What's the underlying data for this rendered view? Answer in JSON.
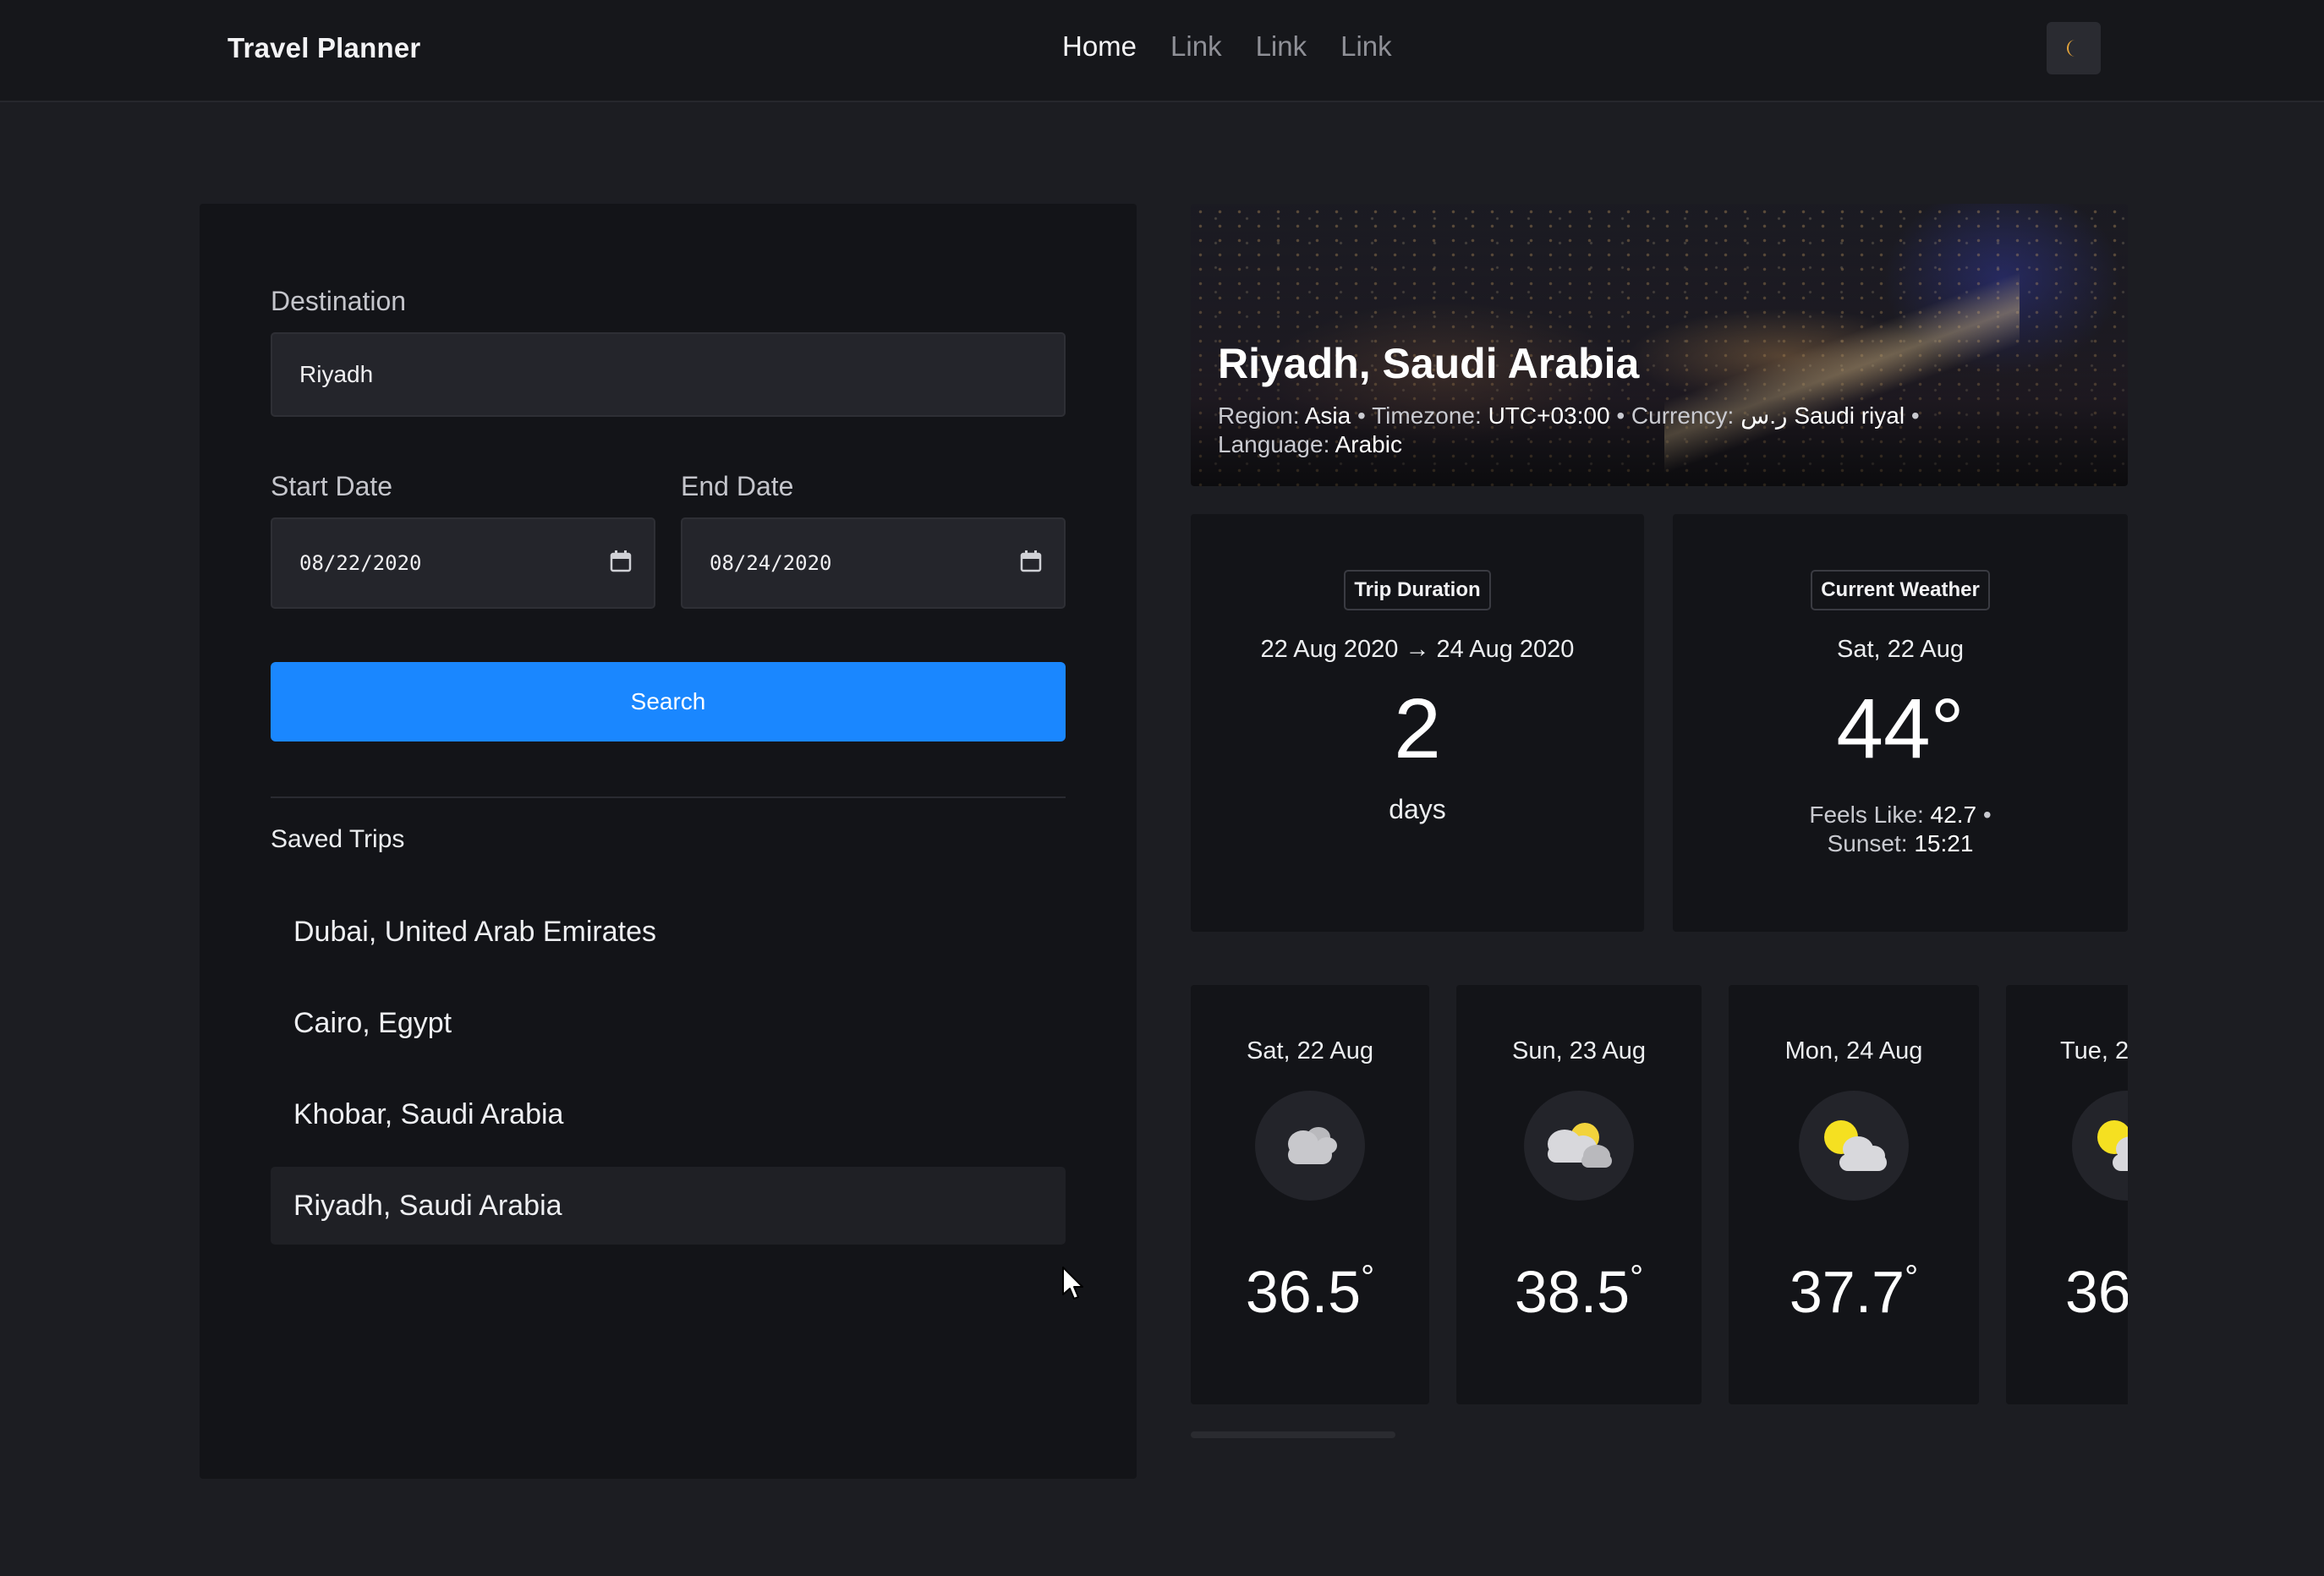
{
  "navbar": {
    "brand": "Travel Planner",
    "links": [
      {
        "label": "Home",
        "active": true
      },
      {
        "label": "Link",
        "active": false
      },
      {
        "label": "Link",
        "active": false
      },
      {
        "label": "Link",
        "active": false
      }
    ],
    "theme_toggle_icon": "moon-icon",
    "accent_moon": "#e3a43b"
  },
  "search_form": {
    "destination_label": "Destination",
    "destination_value": "Riyadh",
    "start_label": "Start Date",
    "start_value": "08/22/2020",
    "end_label": "End Date",
    "end_value": "08/24/2020",
    "search_label": "Search",
    "button_color": "#1a87ff"
  },
  "saved_trips": {
    "title": "Saved Trips",
    "items": [
      "Dubai, United Arab Emirates",
      "Cairo, Egypt",
      "Khobar, Saudi Arabia",
      "Riyadh, Saudi Arabia"
    ],
    "selected_index": 3
  },
  "destination": {
    "title": "Riyadh, Saudi Arabia",
    "region_label": "Region:",
    "region": "Asia",
    "timezone_label": "Timezone:",
    "timezone": "UTC+03:00",
    "currency_label": "Currency:",
    "currency": "ر.س Saudi riyal",
    "language_label": "Language:",
    "language": "Arabic",
    "separator": "•"
  },
  "trip_duration": {
    "badge": "Trip Duration",
    "range": "22 Aug 2020 → 24 Aug 2020",
    "value": "2",
    "unit": "days"
  },
  "current_weather": {
    "badge": "Current Weather",
    "date": "Sat, 22 Aug",
    "temp": "44°",
    "feels_like_label": "Feels Like:",
    "feels_like": "42.7",
    "sunset_label": "Sunset:",
    "sunset": "15:21"
  },
  "forecast": [
    {
      "date": "Sat, 22 Aug",
      "temp": "36.5",
      "icon": "cloud-icon"
    },
    {
      "date": "Sun, 23 Aug",
      "temp": "38.5",
      "icon": "partly-cloudy-icon"
    },
    {
      "date": "Mon, 24 Aug",
      "temp": "37.7",
      "icon": "sun-behind-cloud-icon"
    },
    {
      "date": "Tue, 2",
      "temp": "36",
      "icon": "sun-behind-cloud-icon"
    }
  ],
  "degree_symbol": "°"
}
